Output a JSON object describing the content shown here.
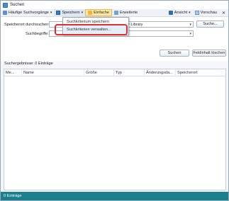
{
  "window": {
    "title": "Suchen"
  },
  "toolbar": {
    "recent_label": "Häufige Suchvorgänge",
    "save_label": "Speichern",
    "simple_label": "Einfache",
    "extended_label": "Erweiterte",
    "view_label": "Ansicht",
    "preview_label": "Vorschau",
    "close_symbol": "✕"
  },
  "save_menu": {
    "items": [
      "Suchkriterium speichern",
      "Suchkriterien verwalten..."
    ]
  },
  "form": {
    "location_label": "Speicherort durchsuchen:",
    "location_value": "y Library",
    "browse_label": "Suche...",
    "terms_label": "Suchbegriffe:",
    "terms_value": "",
    "search_button": "Suchen",
    "clear_button": "Feldinhalt löschen"
  },
  "results": {
    "label": "Suchergebnisse: 0 Einträge",
    "columns": [
      "Me...",
      "Name",
      "Größe",
      "Typ",
      "Änderungsda...",
      "Speicherort"
    ]
  },
  "status": {
    "text": "0 Einträge"
  },
  "colors": {
    "status_bar": "#1a7f8f",
    "highlight": "#e32b2b",
    "active_button": "#ffe8a6"
  }
}
